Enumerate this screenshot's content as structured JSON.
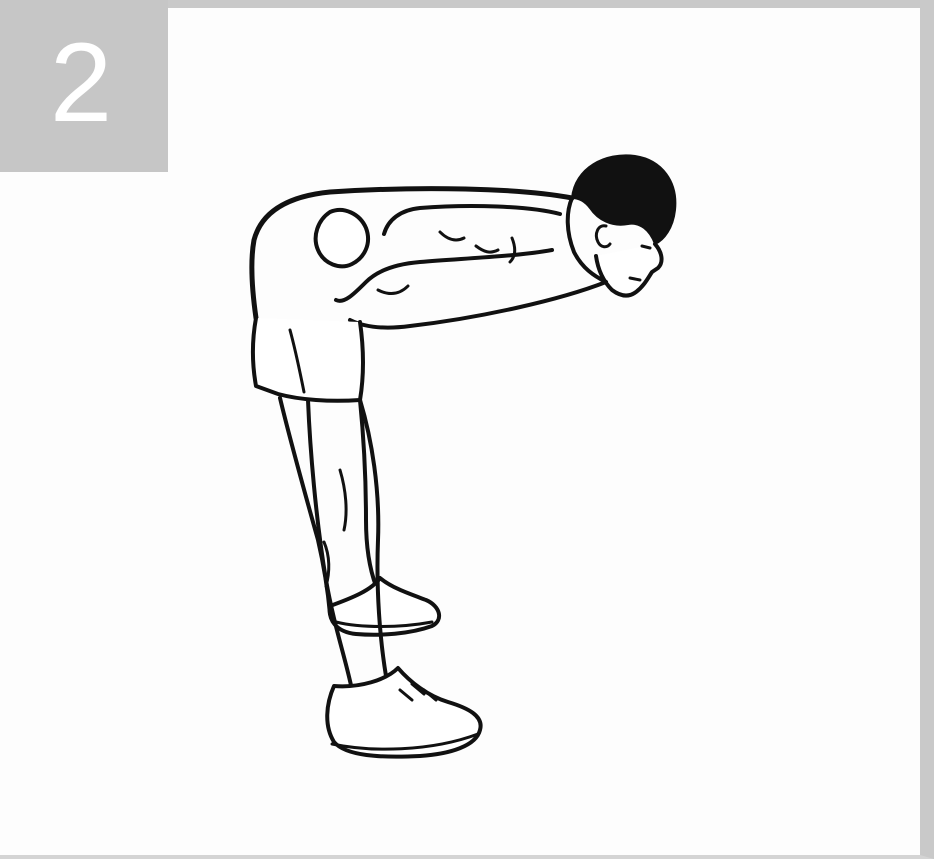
{
  "step": {
    "number": "2"
  },
  "illustration": {
    "subject": "person-bending-forward-stretch",
    "colors": {
      "badge": "#c6c6c6",
      "frame": "#c9c9c9",
      "ink": "#111111",
      "background": "#fdfdfd"
    }
  }
}
